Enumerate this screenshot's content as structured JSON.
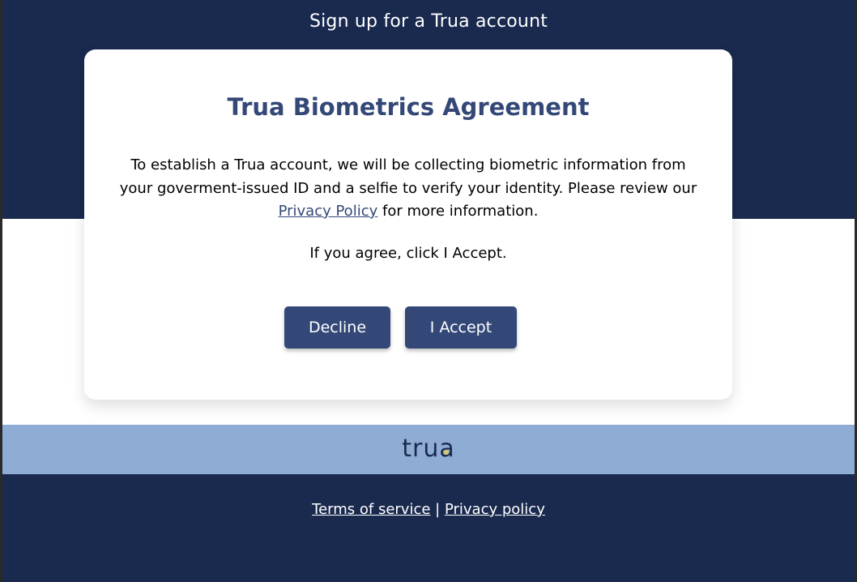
{
  "header": {
    "title": "Sign up for a Trua account"
  },
  "dialog": {
    "title": "Trua Biometrics Agreement",
    "body_text": "To establish a Trua account, we will be collecting biometric information from your goverment-issued ID and a selfie to verify your identity. Please review our",
    "privacy_link": "Privacy Policy",
    "body_suffix": "for more information.",
    "note": "If you agree, click I Accept.",
    "decline_label": "Decline",
    "accept_label": "I Accept"
  },
  "brand": {
    "logo_text": "trua"
  },
  "footer": {
    "terms_label": "Terms of service",
    "separator": "|",
    "privacy_label": "Privacy policy"
  },
  "colors": {
    "navy": "#1a2a4f",
    "accent": "#344878",
    "light_blue": "#8eacd4"
  }
}
